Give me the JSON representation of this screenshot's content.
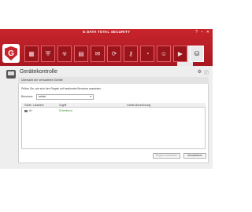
{
  "window": {
    "title": "G DATA TOTAL SECURITY",
    "controls": [
      "?",
      "–",
      "✕"
    ]
  },
  "modules": [
    {
      "icon": "dashboard-icon",
      "glyph": "▦"
    },
    {
      "icon": "shield-icon",
      "glyph": "⛨"
    },
    {
      "icon": "biohazard-icon",
      "glyph": "☣"
    },
    {
      "icon": "firewall-icon",
      "glyph": "▤"
    },
    {
      "icon": "envelope-icon",
      "glyph": "✉"
    },
    {
      "icon": "backup-icon",
      "glyph": "⟳"
    },
    {
      "icon": "password-icon",
      "glyph": "⚷"
    },
    {
      "icon": "tuneup-icon",
      "glyph": "◔"
    },
    {
      "icon": "parental-icon",
      "glyph": "☺"
    },
    {
      "icon": "autostart-icon",
      "glyph": "▶"
    },
    {
      "icon": "device-control-icon",
      "glyph": "⛁"
    }
  ],
  "page": {
    "title": "Gerätekontrolle",
    "subheader": "Übersicht der verwalteten Geräte",
    "description": "Prüfen Sie, wie sich Ihre Regeln auf bestimmte Benutzer auswirken",
    "user_label": "Benutzer:",
    "user_value": "admin"
  },
  "table": {
    "columns": [
      "Gerät / Laufwerk",
      "Zugriff",
      "Geräte-Bezeichnung"
    ],
    "rows": [
      {
        "device": "A:\\",
        "access": "Schreibend",
        "name": ""
      }
    ]
  },
  "buttons": {
    "edit_rule": "Regeln bearbeiten",
    "refresh": "Aktualisieren"
  }
}
